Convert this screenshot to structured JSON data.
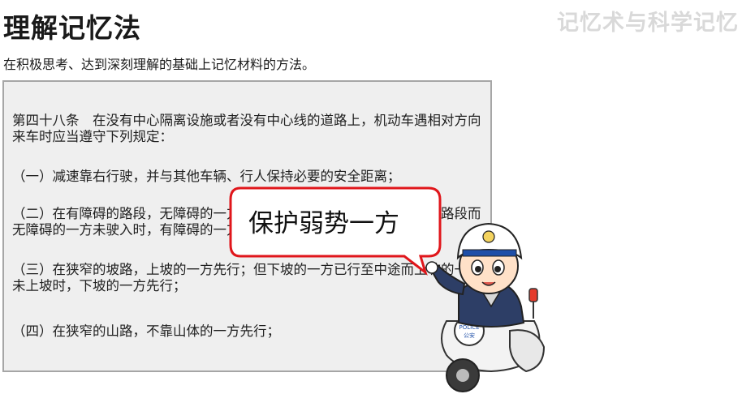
{
  "header": {
    "title": "理解记忆法",
    "watermark": "记忆术与科学记忆",
    "subtitle": "在积极思考、达到深刻理解的基础上记忆材料的方法。"
  },
  "panel": {
    "paragraphs": [
      "第四十八条　在没有中心隔离设施或者没有中心线的道路上，机动车遇相对方向来车时应当遵守下列规定：",
      "（一）减速靠右行驶，并与其他车辆、行人保持必要的安全距离；",
      "（二）在有障碍的路段，无障碍的一方先行；但有障碍的一方已驶入障碍路段而无障碍的一方未驶入时，有障碍的一方先行；",
      "（三）在狭窄的坡路，上坡的一方先行；但下坡的一方已行至中途而上坡的一方未上坡时，下坡的一方先行；",
      "（四）在狭窄的山路，不靠山体的一方先行；"
    ]
  },
  "callout": {
    "text": "保护弱势一方",
    "border_color": "#e0161b"
  },
  "officer": {
    "badge_text": "POLICE",
    "badge_sub": "公安",
    "helmet_icon": "police-badge-icon"
  },
  "colors": {
    "panel_bg": "#efefef",
    "panel_border": "#a6a6a6",
    "watermark": "#d9d9d9"
  }
}
